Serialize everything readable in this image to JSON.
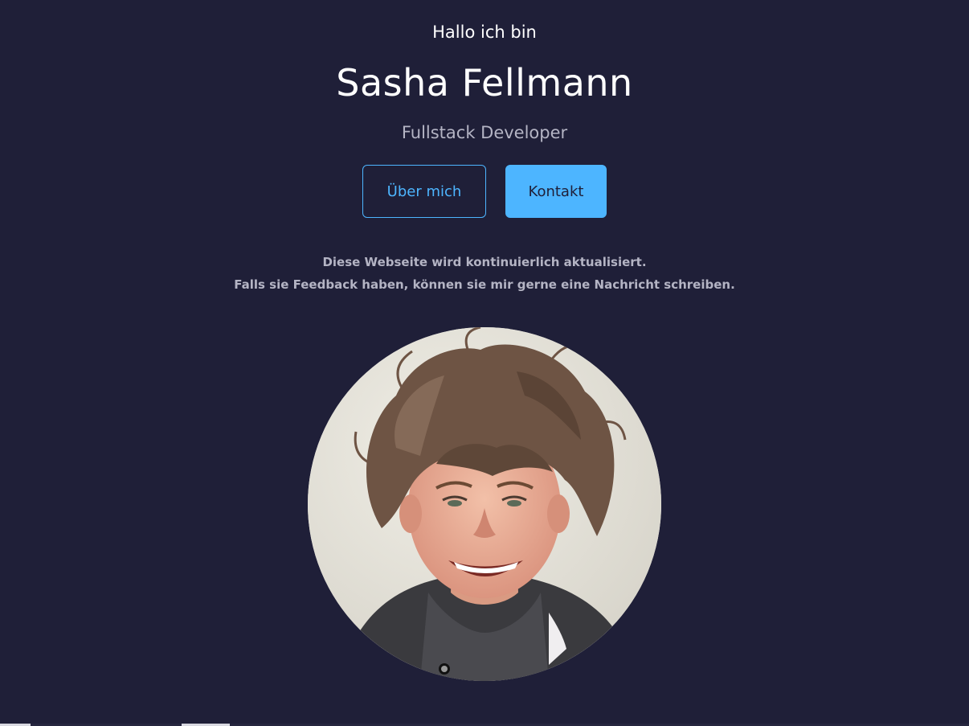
{
  "header": {
    "greeting": "Hallo ich bin",
    "name": "Sasha Fellmann",
    "role": "Fullstack Developer"
  },
  "buttons": {
    "about_label": "Über mich",
    "contact_label": "Kontakt"
  },
  "notice": {
    "line1": "Diese Webseite wird kontinuierlich aktualisiert.",
    "line2": "Falls sie Feedback haben, können sie mir gerne eine Nachricht schreiben."
  },
  "portrait": {
    "alt": "Portrait"
  },
  "colors": {
    "background": "#1f1f38",
    "accent": "#4db5ff",
    "text": "#ffffff",
    "muted": "#b4b4c4"
  }
}
